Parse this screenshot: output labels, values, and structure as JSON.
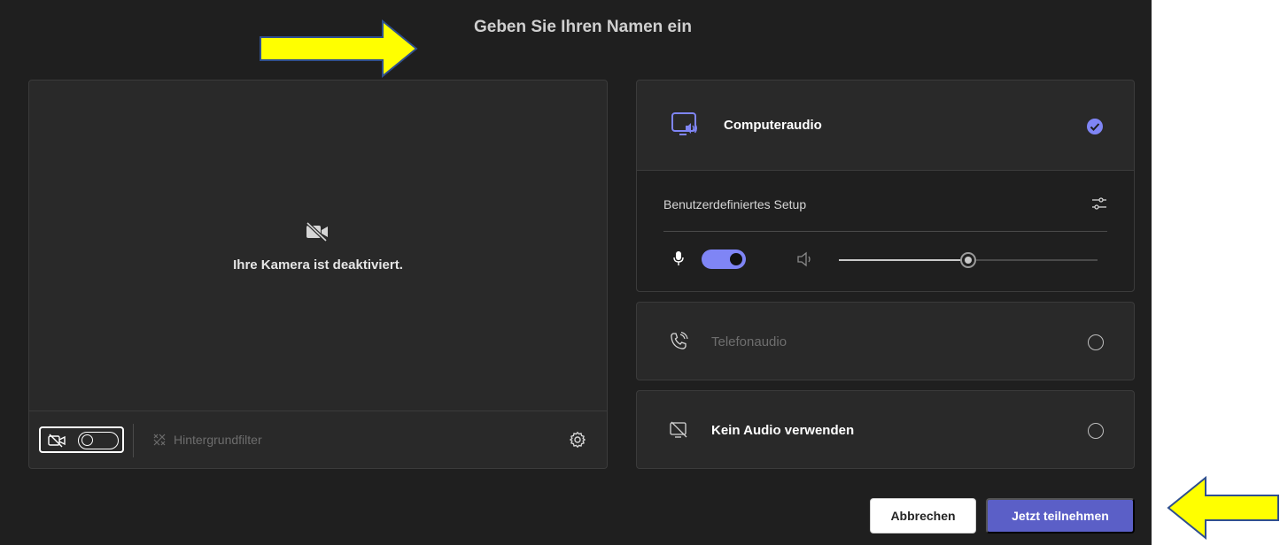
{
  "dialog": {
    "title": "Geben Sie Ihren Namen ein"
  },
  "camera": {
    "status_text": "Ihre Kamera ist deaktiviert.",
    "toggle_on": false,
    "background_filter_label": "Hintergrundfilter"
  },
  "audio_options": {
    "computer": {
      "label": "Computeraudio",
      "selected": true,
      "setup_label": "Benutzerdefiniertes Setup",
      "mic_on": true,
      "speaker_volume": 0.5
    },
    "phone": {
      "label": "Telefonaudio",
      "selected": false
    },
    "none": {
      "label": "Kein Audio verwenden",
      "selected": false
    }
  },
  "buttons": {
    "cancel_label": "Abbrechen",
    "join_label": "Jetzt teilnehmen"
  },
  "colors": {
    "background": "#1f1f1f",
    "panel": "#292929",
    "accent": "#7f85f5",
    "join_button": "#5b5fc7",
    "annotation_arrow": "#ffff00"
  }
}
